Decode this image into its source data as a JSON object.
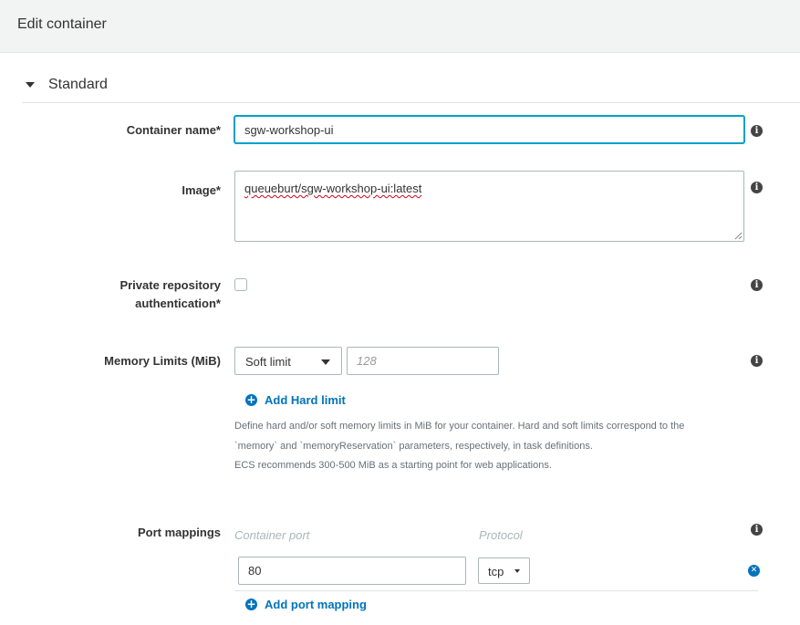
{
  "header": {
    "title": "Edit container"
  },
  "section": {
    "title": "Standard"
  },
  "container_name": {
    "label": "Container name*",
    "value": "sgw-workshop-ui"
  },
  "image": {
    "label": "Image*",
    "value": "queueburt/sgw-workshop-ui:latest"
  },
  "private_repo": {
    "label_line1": "Private repository",
    "label_line2": "authentication*",
    "checked": false
  },
  "memory": {
    "label": "Memory Limits (MiB)",
    "limit_type": "Soft limit",
    "placeholder": "128",
    "add_hard_limit": "Add Hard limit",
    "help_line1": "Define hard and/or soft memory limits in MiB for your container. Hard and soft limits correspond to the",
    "help_line2": "`memory` and `memoryReservation` parameters, respectively, in task definitions.",
    "help_line3": "ECS recommends 300-500 MiB as a starting point for web applications."
  },
  "ports": {
    "label": "Port mappings",
    "col_container_port": "Container port",
    "col_protocol": "Protocol",
    "rows": [
      {
        "container_port": "80",
        "protocol": "tcp"
      }
    ],
    "add_mapping": "Add port mapping"
  },
  "icons": {
    "info": "info-icon",
    "add": "plus-circle-icon",
    "remove": "remove-circle-icon"
  },
  "colors": {
    "link": "#0073bb",
    "focus": "#00a1c9",
    "header_bg": "#f2f3f3"
  }
}
